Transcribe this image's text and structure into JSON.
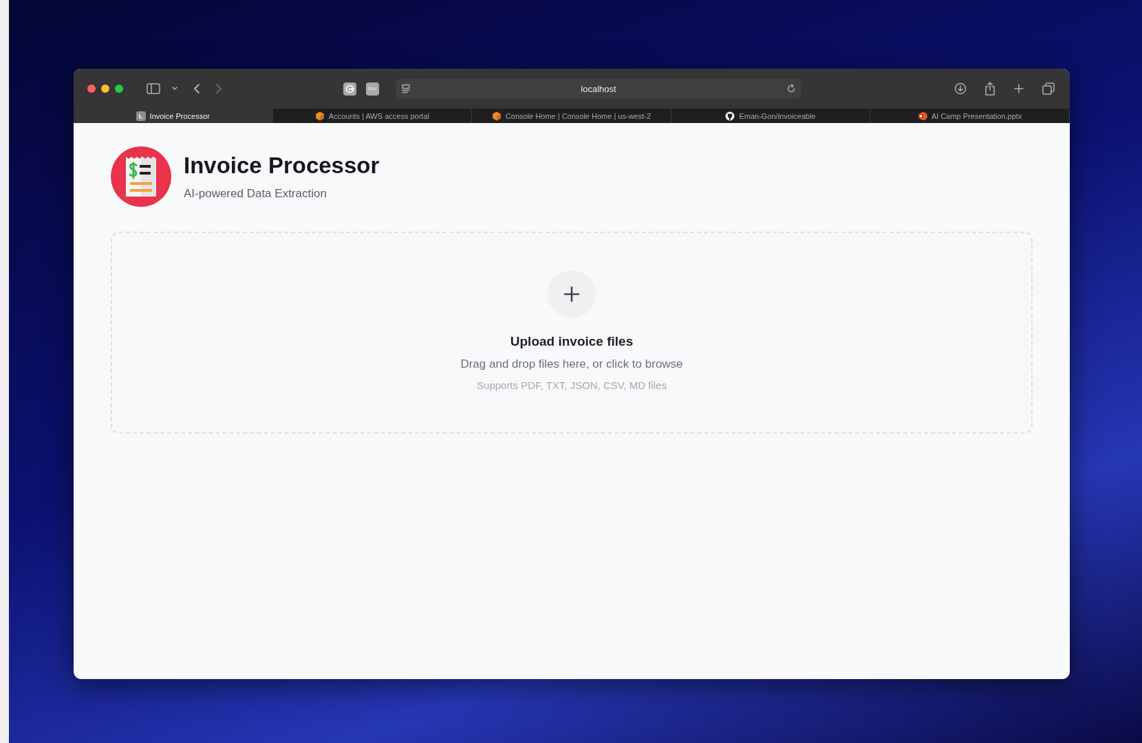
{
  "browser": {
    "toolbar": {
      "back_disabled": false,
      "forward_disabled": true,
      "extensions": [
        {
          "kind": "plug"
        },
        {
          "kind": "box",
          "label": "box"
        }
      ],
      "address": "localhost"
    },
    "tabs": [
      {
        "label": "Invoice Processor",
        "selected": true,
        "kind": "letter",
        "letter": "L"
      },
      {
        "label": "Accounts | AWS access portal",
        "selected": false,
        "kind": "hexagon"
      },
      {
        "label": "Console Home | Console Home | us-west-2",
        "selected": false,
        "kind": "hexagon"
      },
      {
        "label": "Eman-Gon/invoiceable",
        "selected": false,
        "kind": "cat"
      },
      {
        "label": "AI Camp Presentation.pptx",
        "selected": false,
        "kind": "slides"
      }
    ]
  },
  "page": {
    "title": "Invoice Processor",
    "subtitle": "AI-powered Data Extraction",
    "upload": {
      "heading": "Upload invoice files",
      "instruction": "Drag and drop files here, or click to browse",
      "formats": "Supports PDF, TXT, JSON, CSV, MD files"
    }
  }
}
